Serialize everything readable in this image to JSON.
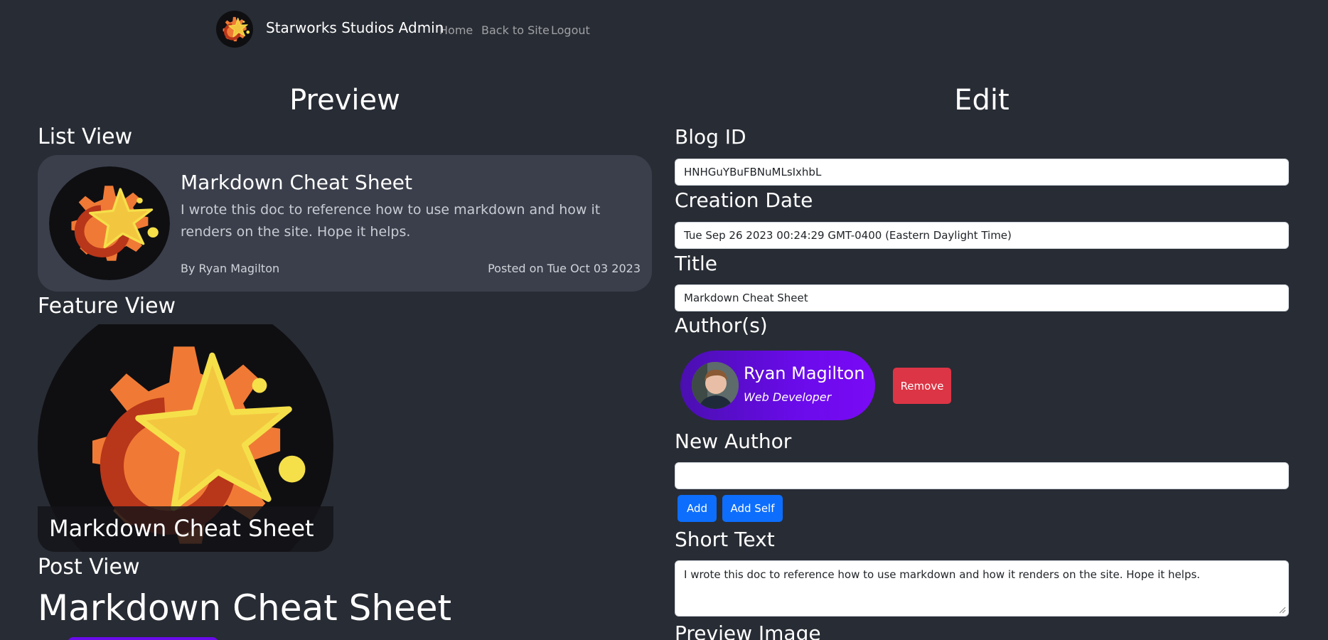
{
  "nav": {
    "brand": "Starworks Studios Admin",
    "logo_icon": "gear-star-logo",
    "links": [
      "Home",
      "Back to Site",
      "Logout"
    ]
  },
  "preview": {
    "heading": "Preview",
    "list_view_label": "List View",
    "feature_view_label": "Feature View",
    "post_view_label": "Post View",
    "card": {
      "title": "Markdown Cheat Sheet",
      "description": "I wrote this doc to reference how to use markdown and how it renders on the site. Hope it helps.",
      "author": "By Ryan Magilton",
      "date": "Posted on Tue Oct 03 2023"
    },
    "feature_title": "Markdown Cheat Sheet",
    "post_title": "Markdown Cheat Sheet"
  },
  "edit": {
    "heading": "Edit",
    "blog_id_label": "Blog ID",
    "blog_id_value": "HNHGuYBuFBNuMLsIxhbL",
    "creation_date_label": "Creation Date",
    "creation_date_value": "Tue Sep 26 2023 00:24:29 GMT-0400 (Eastern Daylight Time)",
    "title_label": "Title",
    "title_value": "Markdown Cheat Sheet",
    "authors_label": "Author(s)",
    "author": {
      "name": "Ryan Magilton",
      "role": "Web Developer"
    },
    "remove_label": "Remove",
    "new_author_label": "New Author",
    "new_author_value": "",
    "add_label": "Add",
    "add_self_label": "Add Self",
    "short_text_label": "Short Text",
    "short_text_value": "I wrote this doc to reference how to use markdown and how it renders on the site. Hope it helps.",
    "preview_image_label": "Preview Image"
  },
  "colors": {
    "background": "#282c34",
    "card": "#3a3f4b",
    "danger": "#dc3545",
    "primary": "#0d6efd",
    "author_gradient_start": "#4a0fb0",
    "author_gradient_end": "#7a0af5"
  }
}
